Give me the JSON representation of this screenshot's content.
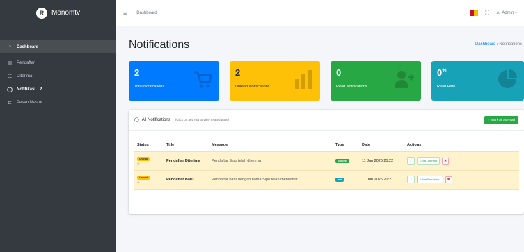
{
  "brand": {
    "logo_letter": "R",
    "name": "Monomtv"
  },
  "sidebar": {
    "items": [
      {
        "label": "Dashboard",
        "icon": "dashboard-icon",
        "glyph": "◔"
      },
      {
        "label": "Pendaftar",
        "icon": "chart-icon",
        "glyph": "▥"
      },
      {
        "label": "Diterima",
        "icon": "list-icon",
        "glyph": "☷"
      },
      {
        "label": "Notifikasi",
        "icon": "bell-icon",
        "glyph": "◯",
        "badge": "2"
      },
      {
        "label": "Pesan Masuk",
        "icon": "inbox-icon",
        "glyph": "⊏"
      }
    ]
  },
  "topbar": {
    "menu_glyph": "≡",
    "crumb": "Dashboard",
    "expand_glyph": "⛶",
    "user_glyph": "♙",
    "user_label": "Admin ▾"
  },
  "page": {
    "title": "Notifications",
    "breadcrumb_home": "Dashboard",
    "breadcrumb_sep": "/",
    "breadcrumb_current": "Notifications"
  },
  "boxes": [
    {
      "value": "2",
      "label": "Total Notifications",
      "icon": "cart-icon"
    },
    {
      "value": "2",
      "label": "Unread Notifications",
      "icon": "bars-icon"
    },
    {
      "value": "0",
      "label": "Read Notifications",
      "icon": "user-plus-icon"
    },
    {
      "value": "0",
      "value_sup": "%",
      "label": "Read Rate",
      "icon": "pie-icon"
    }
  ],
  "card": {
    "title_glyph": "◯",
    "title": "All Notifications",
    "subtitle": "(Click on any row to view related page)",
    "mark_button": "✓ Mark All as Read"
  },
  "table": {
    "headers": [
      "Status",
      "Title",
      "Message",
      "Type",
      "Date",
      "Actions"
    ],
    "rows": [
      {
        "status": "Unread",
        "status_dot": "◎",
        "title": "Pendaftar Diterima",
        "message": "Pendaftar Sipo telah diterima",
        "type": "Success",
        "date": "11 Jun 2026 21:22",
        "check": "✓",
        "view": "Lihat Diterima",
        "del": "✖"
      },
      {
        "status": "Unread",
        "status_dot": "◎",
        "title": "Pendaftar Baru",
        "message": "Pendaftar baru dengan nama Sipo telah mendaftar",
        "type": "Info",
        "date": "11 Jun 2026 21:21",
        "check": "✓",
        "view": "Lihat Pendaftar",
        "del": "✖"
      }
    ]
  },
  "colors": {
    "sidebar": "#343a40",
    "primary": "#007bff",
    "warning": "#ffc107",
    "success": "#28a745",
    "info": "#17a2b8",
    "row_highlight": "#fff3cd",
    "flag_red": "#c8102e",
    "flag_yellow": "#f6c000"
  }
}
